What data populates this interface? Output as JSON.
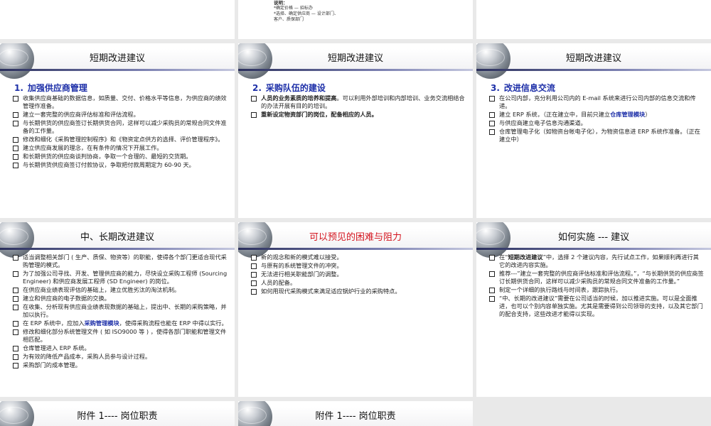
{
  "top_note": {
    "heading": "说明：",
    "lines": [
      "*确定价格 — 招标办",
      "*选择、确定供应商 — 设计部门、",
      "客户、质保部门"
    ]
  },
  "slides": {
    "s1": {
      "title": "短期改进建议",
      "section_num": "1.",
      "section_title": "加强供应商管理",
      "items": [
        "收集供应商基础的数据信息，如质量、交付、价格水平等信息，为供应商的绩效管理作准备。",
        "建立一套完整的供应商评估标准和评估流程。",
        "与长期供货的供应商签订长期供货合同，这样可以减少采购员的常规合同文件准备的工作量。",
        "修改和细化《采购管理控制程序》和《物资定点供方的选择、评价管理程序》。",
        "建立供应商发展的理念，在有条件的情况下开展工作。",
        "和长期供货的供应商谈判协商，争取一个合理的、最短的交货期。",
        "与长期供货供应商签订付款协议，争取把付款周期定为 60-90 天。"
      ]
    },
    "s2": {
      "title": "短期改进建议",
      "section_num": "2.",
      "section_title": "采购队伍的建设",
      "item1_bold": "人员的业务素质的培养和提高",
      "item1_rest": "。可以利用外部培训和内部培训、业务交流相结合的办法开展有目的的培训。",
      "item2": "重新设定物资部门的岗位，配备相应的人员。"
    },
    "s3": {
      "title": "短期改进建议",
      "section_num": "3.",
      "section_title": "改进信息交流",
      "item1": "在公司内部，充分利用公司内的 E-mail 系统来进行公司内部的信息交流和传递。",
      "item2_pre": "建立 ERP 系统，（正在建立中，目前只建立",
      "item2_hl": "仓库管理模块",
      "item2_post": "）",
      "item3": "与供应商建立电子信息沟通渠道。",
      "item4": "仓库管理电子化（如物资台帐电子化），为物资信息进 ERP 系统作准备。（正在建立中）"
    },
    "s4": {
      "title": "中、长期改进建议",
      "items_a": [
        "适当调整相关部门 ( 生产、质保、物资等）的职能，使得各个部门更适合现代采购管理的模式。",
        "为了加强公司寻找、开发、管理供应商的能力，尽快设立采购工程师 (Sourcing Engineer) 和供应商发展工程师 (SD Engineer) 的岗位。",
        "在供应商业绩表现评估的基础上，建立优胜劣汰的淘汰机制。",
        "建立和供应商的电子数据的交换。",
        "在收集、分析现有供应商业绩表现数据的基础上，提出中、长期的采购策略，并加以执行。"
      ],
      "erp_pre": "在 ERP 系统中，应加入",
      "erp_hl": "采购管理模块",
      "erp_post": "，使得采购流程也能在 ERP 中得以实行。",
      "items_b": [
        "修改和细化部分系统管理文件 ( 如 ISO9000 等 ) ，使得各部门职能和管理文件相匹配。",
        "仓库管理进入 ERP 系统。",
        "为有效的降低产品成本，采购人员参与设计过程。",
        "采购部门的成本管理。"
      ]
    },
    "s5": {
      "title": "可以预见的困难与阻力",
      "items": [
        "新的观念和新的模式难以接受。",
        "与原有的系统管理文件的冲突。",
        "无法进行相关职能部门的调整。",
        "人员的配备。",
        "如何用现代采购模式来满足适应锅炉行业的采购特点。"
      ]
    },
    "s6": {
      "title": "如何实施 --- 建议",
      "item1_pre": "在“",
      "item1_bold": "短期改进建议",
      "item1_post": "”中，选择 2 个建议内容，先行试点工作，如果顺利再进行其它的改进内容实施。",
      "item2": "推荐---”建立一套完整的供应商评估标准和评估流程。”，“与长期供货的供应商签订长期供货合同，这样可以减少采购员的常规合同文件准备的工作量。”",
      "item3": "制定一个详细的执行路线与时间表，跟踪执行。",
      "item4": "“中、长期的改进建议”需要在公司适当的时候，加以推进实施。可以是全面推进，也可以个别内容单独实施。尤其是需要得到公司领导的支持，以及其它部门的配合支持，这些改进才能得以实现。"
    },
    "s7": {
      "title": "附件 1---- 岗位职责"
    },
    "s8": {
      "title": "附件 1---- 岗位职责"
    }
  }
}
